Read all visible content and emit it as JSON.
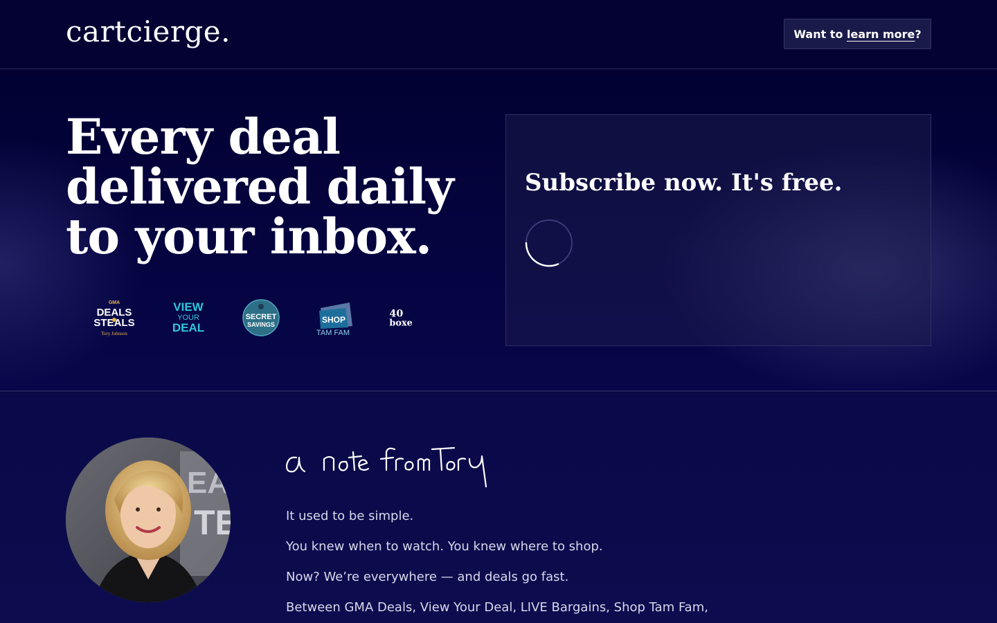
{
  "header": {
    "logo": "cartcierge.",
    "learn_prefix": "Want to ",
    "learn_link": "learn more",
    "learn_suffix": "?"
  },
  "hero": {
    "headline_lines": [
      "Every deal",
      "delivered daily",
      "to your inbox."
    ],
    "media_logos": [
      {
        "name": "gma-deals-steals-logo",
        "text_top": "GMA",
        "text_main": "DEALS & STEALS",
        "text_sub": "Tory Johnson"
      },
      {
        "name": "view-your-deal-logo",
        "lines": [
          "VIEW",
          "YOUR",
          "DEAL"
        ]
      },
      {
        "name": "secret-savings-logo",
        "lines": [
          "SECRET",
          "SAVINGS"
        ]
      },
      {
        "name": "shop-tam-fam-logo",
        "lines": [
          "SHOP",
          "TAM FAM"
        ]
      },
      {
        "name": "40-boxes-logo",
        "lines": [
          "40",
          "boxes"
        ]
      }
    ]
  },
  "subscribe": {
    "title": "Subscribe now. It's free.",
    "loading": true
  },
  "note": {
    "signature": "a note from Tory",
    "paragraphs": [
      "It used to be simple.",
      "You knew when to watch. You knew where to shop.",
      "Now? We’re everywhere — and deals go fast.",
      "Between GMA Deals, View Your Deal, LIVE Bargains, Shop Tam Fam,"
    ]
  },
  "colors": {
    "background": "#03033a",
    "button_bg": "#1a1a4a",
    "accent_teal": "#2fc7d8",
    "accent_gold": "#e7b545"
  }
}
